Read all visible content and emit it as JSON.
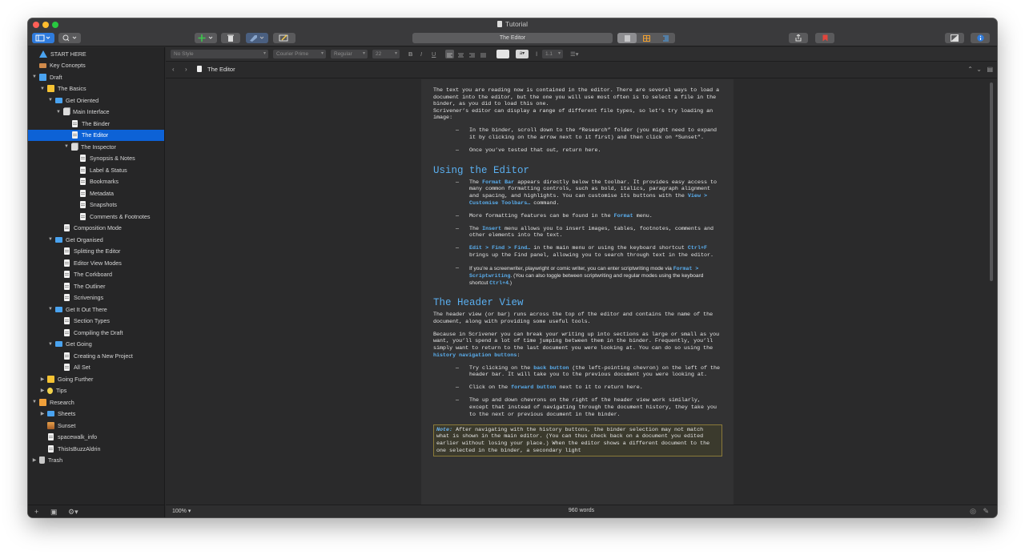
{
  "window": {
    "title": "Tutorial"
  },
  "toolbar": {
    "document_title": "The Editor"
  },
  "binder": {
    "items": [
      {
        "label": "START HERE",
        "icon": "warning-icon",
        "depth": 0,
        "disclosure": ""
      },
      {
        "label": "Key Concepts",
        "icon": "key-concepts-icon",
        "depth": 0,
        "disclosure": ""
      },
      {
        "label": "Draft",
        "icon": "draft-icon",
        "depth": 0,
        "disclosure": "▼"
      },
      {
        "label": "The Basics",
        "icon": "yellow-folder-icon",
        "depth": 1,
        "disclosure": "▼"
      },
      {
        "label": "Get Oriented",
        "icon": "folder-icon",
        "depth": 2,
        "disclosure": "▼"
      },
      {
        "label": "Main Interface",
        "icon": "stack-icon",
        "depth": 3,
        "disclosure": "▼"
      },
      {
        "label": "The Binder",
        "icon": "document-icon",
        "depth": 4,
        "disclosure": ""
      },
      {
        "label": "The Editor",
        "icon": "document-icon",
        "depth": 4,
        "disclosure": "",
        "selected": true
      },
      {
        "label": "The Inspector",
        "icon": "stack-icon",
        "depth": 4,
        "disclosure": "▼"
      },
      {
        "label": "Synopsis & Notes",
        "icon": "document-icon",
        "depth": 5,
        "disclosure": ""
      },
      {
        "label": "Label & Status",
        "icon": "document-icon",
        "depth": 5,
        "disclosure": ""
      },
      {
        "label": "Bookmarks",
        "icon": "document-icon",
        "depth": 5,
        "disclosure": ""
      },
      {
        "label": "Metadata",
        "icon": "document-icon",
        "depth": 5,
        "disclosure": ""
      },
      {
        "label": "Snapshots",
        "icon": "document-icon",
        "depth": 5,
        "disclosure": ""
      },
      {
        "label": "Comments & Footnotes",
        "icon": "document-icon",
        "depth": 5,
        "disclosure": ""
      },
      {
        "label": "Composition Mode",
        "icon": "document-icon",
        "depth": 3,
        "disclosure": ""
      },
      {
        "label": "Get Organised",
        "icon": "folder-icon",
        "depth": 2,
        "disclosure": "▼"
      },
      {
        "label": "Splitting the Editor",
        "icon": "document-icon",
        "depth": 3,
        "disclosure": ""
      },
      {
        "label": "Editor View Modes",
        "icon": "document-icon",
        "depth": 3,
        "disclosure": ""
      },
      {
        "label": "The Corkboard",
        "icon": "document-icon",
        "depth": 3,
        "disclosure": ""
      },
      {
        "label": "The Outliner",
        "icon": "document-icon",
        "depth": 3,
        "disclosure": ""
      },
      {
        "label": "Scrivenings",
        "icon": "document-icon",
        "depth": 3,
        "disclosure": ""
      },
      {
        "label": "Get It Out There",
        "icon": "folder-icon",
        "depth": 2,
        "disclosure": "▼"
      },
      {
        "label": "Section Types",
        "icon": "document-icon",
        "depth": 3,
        "disclosure": ""
      },
      {
        "label": "Compiling the Draft",
        "icon": "document-icon",
        "depth": 3,
        "disclosure": ""
      },
      {
        "label": "Get Going",
        "icon": "folder-icon",
        "depth": 2,
        "disclosure": "▼"
      },
      {
        "label": "Creating a New Project",
        "icon": "document-icon",
        "depth": 3,
        "disclosure": ""
      },
      {
        "label": "All Set",
        "icon": "document-icon",
        "depth": 3,
        "disclosure": ""
      },
      {
        "label": "Going Further",
        "icon": "yellow-folder-icon",
        "depth": 1,
        "disclosure": "▶"
      },
      {
        "label": "Tips",
        "icon": "lightbulb-icon",
        "depth": 1,
        "disclosure": "▶"
      },
      {
        "label": "Research",
        "icon": "research-icon",
        "depth": 0,
        "disclosure": "▼"
      },
      {
        "label": "Sheets",
        "icon": "folder-icon",
        "depth": 1,
        "disclosure": "▶"
      },
      {
        "label": "Sunset",
        "icon": "image-icon",
        "depth": 1,
        "disclosure": ""
      },
      {
        "label": "spacewalk_info",
        "icon": "pdf-icon",
        "depth": 1,
        "disclosure": ""
      },
      {
        "label": "ThisIsBuzzAldrin",
        "icon": "document-icon",
        "depth": 1,
        "disclosure": ""
      },
      {
        "label": "Trash",
        "icon": "trash-icon",
        "depth": 0,
        "disclosure": "▶"
      }
    ]
  },
  "formatbar": {
    "style": "No Style",
    "font": "Courier Prime",
    "weight": "Regular",
    "size": "22",
    "line_spacing": "1.1"
  },
  "header_bar": {
    "title": "The Editor"
  },
  "editor": {
    "intro_1": "The text you are reading now is contained in the editor. There are several ways to load a document into the editor, but the one you will use most often is to select a file in the binder, as you did to load this one.",
    "intro_2": "Scrivener’s editor can display a range of different file types, so let’s try loading an image:",
    "bullet_1": "In the binder, scroll down to the “Research” folder (you might need to expand it by clicking on the arrow next to it first) and then click on “Sunset”.",
    "bullet_2": "Once you’ve tested that out, return here.",
    "heading_1": "Using the Editor",
    "b3_pre": "The ",
    "b3_hl1": "Format Bar",
    "b3_mid": " appears directly below the toolbar. It provides easy access to many common formatting controls, such as bold, italics, paragraph alignment and spacing, and highlights. You can customise its buttons with the ",
    "b3_hl2": "View > Customise Toolbars…",
    "b3_post": " command.",
    "b4_pre": "More formatting features can be found in the ",
    "b4_hl": "Format",
    "b4_post": " menu.",
    "b5_pre": "The ",
    "b5_hl": "Insert",
    "b5_post": " menu allows you to insert images, tables, footnotes, comments and other elements into the text.",
    "b6_hl1": "Edit > Find > Find…",
    "b6_mid": " in the main menu or using the keyboard shortcut ",
    "b6_hl2": "Ctrl+F",
    "b6_post": " brings up the Find panel, allowing you to search through text in the editor.",
    "b7_pre": "If you’re a screenwriter, playwright or comic writer, you can enter scriptwriting mode via ",
    "b7_hl1": "Format > Scriptwriting",
    "b7_mid": ". (You can also toggle between scriptwriting and regular modes using the keyboard shortcut ",
    "b7_hl2": "Ctrl+4",
    "b7_post": ".)",
    "heading_2": "The Header View",
    "p3": "The header view (or bar) runs across the top of the editor and contains the name of the document, along with providing some useful tools.",
    "p4_pre": "Because in Scrivener you can break your writing up into sections as large or small as you want, you’ll spend a lot of time jumping between them in the binder. Frequently, you’ll simply want to return to the last document you were looking at. You can do so using the ",
    "p4_hl": "history navigation buttons",
    "p4_post": ":",
    "b8_pre": "Try clicking on the ",
    "b8_hl": "back button",
    "b8_post": " (the left-pointing chevron) on the left of the header bar. It will take you to the previous document you were looking at.",
    "b9_pre": "Click on the ",
    "b9_hl": "forward button",
    "b9_post": " next to it to return here.",
    "b10": "The up and down chevrons on the right of the header view work similarly, except that instead of navigating through the document history, they take you to the next or previous document in the binder.",
    "note_label": "Note:",
    "note_text": " After navigating with the history buttons, the binder selection may not match what is shown in the main editor. (You can thus check back on a document you edited earlier without losing your place.) When the editor shows a different document to the one selected in the binder, a secondary light"
  },
  "footer": {
    "zoom": "100%",
    "word_count": "960 words"
  },
  "colors": {
    "accent": "#0d62d6",
    "link": "#5aaff0",
    "background": "#2a2a2b"
  }
}
